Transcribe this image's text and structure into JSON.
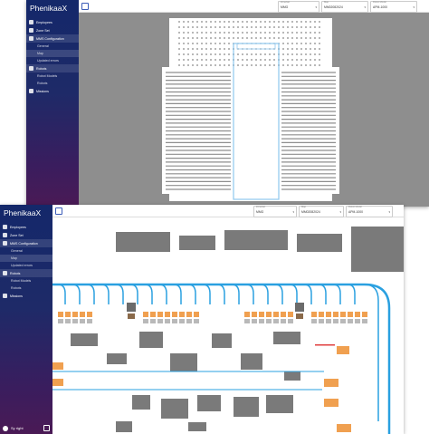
{
  "app": {
    "brand": "PhenikaaX"
  },
  "sidebar": {
    "items": [
      {
        "label": "Employees",
        "icon": "people-icon",
        "level": 0
      },
      {
        "label": "Zone Set",
        "icon": "map-icon",
        "level": 0
      },
      {
        "label": "MMS Configuration",
        "icon": "gear-icon",
        "level": 0
      },
      {
        "label": "General",
        "icon": "",
        "level": 1
      },
      {
        "label": "Map",
        "icon": "",
        "level": 1
      },
      {
        "label": "Updated errors",
        "icon": "",
        "level": 1
      },
      {
        "label": "Robots",
        "icon": "robot-icon",
        "level": 0
      },
      {
        "label": "Robot Models",
        "icon": "",
        "level": 1
      },
      {
        "label": "Robots",
        "icon": "",
        "level": 1
      },
      {
        "label": "Missions",
        "icon": "calendar-icon",
        "level": 0
      }
    ],
    "user": "Sy right"
  },
  "topbar": {
    "field1": {
      "label": "Zone/set",
      "value": "MMG"
    },
    "field2": {
      "label": "Map",
      "value": "MM02082024"
    },
    "field3": {
      "label": "Robot Model",
      "value": "APM-1000"
    }
  },
  "colors": {
    "sidebar_top": "#14286a",
    "sidebar_bottom": "#4a1a55",
    "path": "#2aa0e0",
    "station": "#f0a050",
    "obstacle": "#7a7a7a"
  }
}
